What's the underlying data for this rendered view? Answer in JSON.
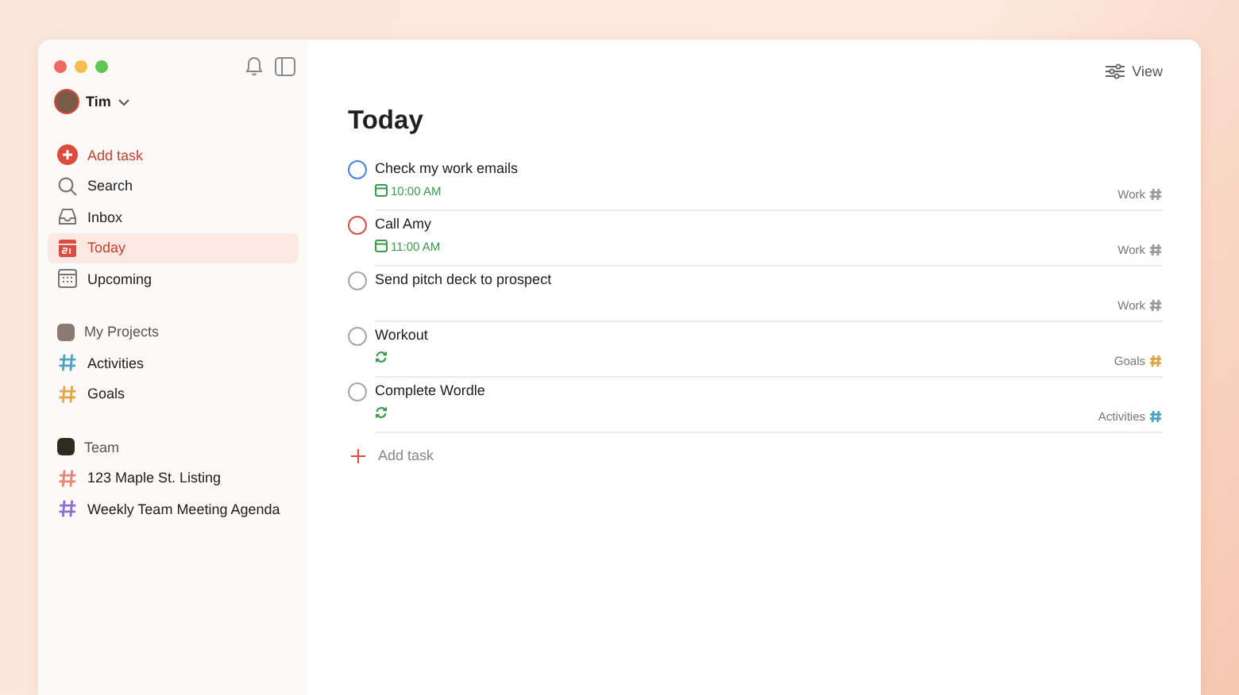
{
  "sidebar": {
    "user": {
      "name": "Tim"
    },
    "add_task": "Add task",
    "nav": [
      {
        "kind": "search",
        "label": "Search",
        "selected": false
      },
      {
        "kind": "inbox",
        "label": "Inbox",
        "selected": false
      },
      {
        "kind": "today",
        "label": "Today",
        "selected": true
      },
      {
        "kind": "upcoming",
        "label": "Upcoming",
        "selected": false
      }
    ],
    "groups": [
      {
        "kind": "personal",
        "title": "My Projects",
        "projects": [
          {
            "name": "Activities",
            "color": "#4fa3c2"
          },
          {
            "name": "Goals",
            "color": "#e0a545"
          }
        ]
      },
      {
        "kind": "team",
        "title": "Team",
        "projects": [
          {
            "name": "123 Maple St. Listing",
            "color": "#e8837a"
          },
          {
            "name": "Weekly Team Meeting Agenda",
            "color": "#8a6fd1"
          }
        ]
      }
    ]
  },
  "toolbar": {
    "view": "View"
  },
  "main": {
    "title": "Today",
    "tasks": [
      {
        "title": "Check my work emails",
        "color": "#4a86d8",
        "due": {
          "kind": "time",
          "text": "10:00 AM"
        },
        "project": {
          "name": "Work",
          "color": "#9a9a9a"
        }
      },
      {
        "title": "Call Amy",
        "color": "#d2544b",
        "due": {
          "kind": "time",
          "text": "11:00 AM"
        },
        "project": {
          "name": "Work",
          "color": "#9a9a9a"
        }
      },
      {
        "title": "Send pitch deck to prospect",
        "color": "#a8a8a8",
        "due": {
          "kind": "none"
        },
        "project": {
          "name": "Work",
          "color": "#9a9a9a"
        }
      },
      {
        "title": "Workout",
        "color": "#a8a8a8",
        "due": {
          "kind": "recurring"
        },
        "project": {
          "name": "Goals",
          "color": "#e0a545"
        }
      },
      {
        "title": "Complete Wordle",
        "color": "#a8a8a8",
        "due": {
          "kind": "recurring"
        },
        "project": {
          "name": "Activities",
          "color": "#4fa3c2"
        }
      }
    ],
    "add_task": "Add task"
  }
}
